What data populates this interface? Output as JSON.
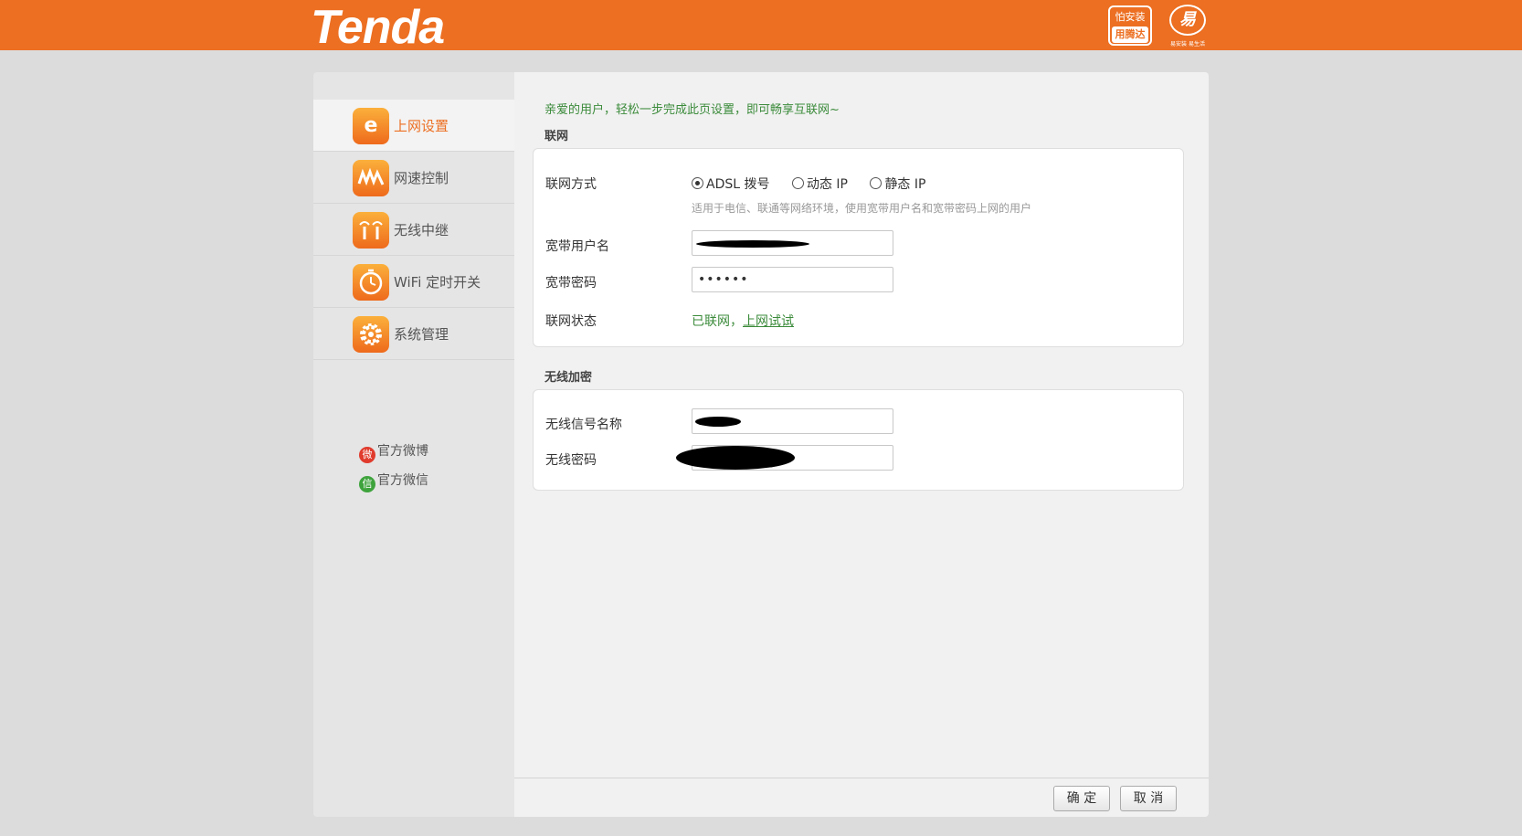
{
  "header": {
    "logo": "Tenda",
    "badge1_top": "怕安装",
    "badge1_bottom": "用腾达",
    "badge2_mark": "易",
    "badge2_sub": "易安装 易生活"
  },
  "sidebar": {
    "items": [
      {
        "label": "上网设置",
        "icon": "ie-e-icon",
        "active": true
      },
      {
        "label": "网速控制",
        "icon": "speed-wave-icon"
      },
      {
        "label": "无线中继",
        "icon": "wireless-relay-icon"
      },
      {
        "label": "WiFi 定时开关",
        "icon": "wifi-timer-icon"
      },
      {
        "label": "系统管理",
        "icon": "gear-icon"
      }
    ],
    "weibo": "官方微博",
    "wechat": "官方微信"
  },
  "main": {
    "welcome": "亲爱的用户，轻松一步完成此页设置，即可畅享互联网~",
    "internet": {
      "title": "联网",
      "mode_label": "联网方式",
      "modes": [
        "ADSL 拨号",
        "动态 IP",
        "静态 IP"
      ],
      "selected_mode": "ADSL 拨号",
      "hint": "适用于电信、联通等网络环境，使用宽带用户名和宽带密码上网的用户",
      "username_label": "宽带用户名",
      "username_value": "",
      "password_label": "宽带密码",
      "password_value": "••••••",
      "status_label": "联网状态",
      "status_value": "已联网，",
      "status_link": "上网试试"
    },
    "wireless": {
      "title": "无线加密",
      "ssid_label": "无线信号名称",
      "ssid_value": "",
      "password_label": "无线密码",
      "password_value": ""
    },
    "buttons": {
      "ok": "确 定",
      "cancel": "取 消"
    }
  },
  "colors": {
    "brand": "#ec6f22",
    "status_green": "#3b8b3b"
  }
}
